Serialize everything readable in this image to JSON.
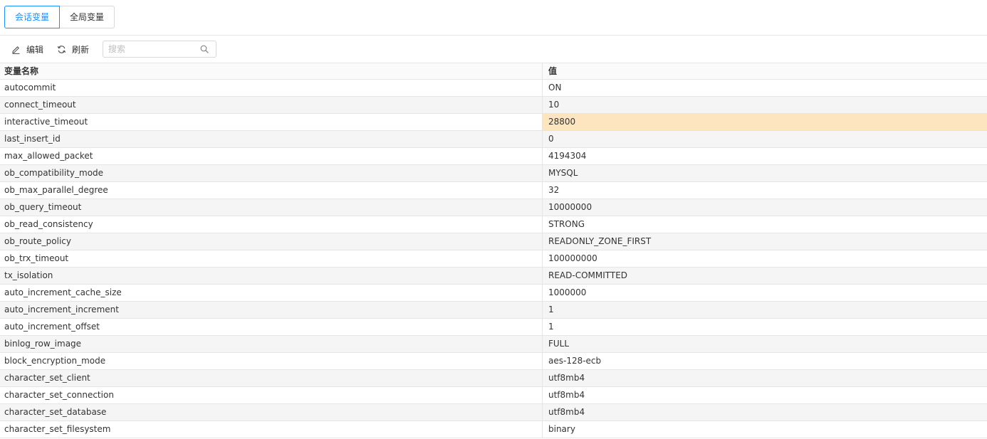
{
  "tabs": [
    {
      "label": "会话变量",
      "active": true
    },
    {
      "label": "全局变量",
      "active": false
    }
  ],
  "toolbar": {
    "edit_label": "编辑",
    "refresh_label": "刷新",
    "search_placeholder": "搜索",
    "search_value": ""
  },
  "icons": {
    "edit": "edit-icon",
    "refresh": "refresh-icon",
    "search": "search-icon"
  },
  "colors": {
    "accent": "#1890ff",
    "selected_cell": "#fde5bf",
    "stripe": "#f5f5f5"
  },
  "table": {
    "columns": [
      "变量名称",
      "值"
    ],
    "selected_row": 2,
    "rows": [
      {
        "name": "autocommit",
        "value": "ON"
      },
      {
        "name": "connect_timeout",
        "value": "10"
      },
      {
        "name": "interactive_timeout",
        "value": "28800"
      },
      {
        "name": "last_insert_id",
        "value": "0"
      },
      {
        "name": "max_allowed_packet",
        "value": "4194304"
      },
      {
        "name": "ob_compatibility_mode",
        "value": "MYSQL"
      },
      {
        "name": "ob_max_parallel_degree",
        "value": "32"
      },
      {
        "name": "ob_query_timeout",
        "value": "10000000"
      },
      {
        "name": "ob_read_consistency",
        "value": "STRONG"
      },
      {
        "name": "ob_route_policy",
        "value": "READONLY_ZONE_FIRST"
      },
      {
        "name": "ob_trx_timeout",
        "value": "100000000"
      },
      {
        "name": "tx_isolation",
        "value": "READ-COMMITTED"
      },
      {
        "name": "auto_increment_cache_size",
        "value": "1000000"
      },
      {
        "name": "auto_increment_increment",
        "value": "1"
      },
      {
        "name": "auto_increment_offset",
        "value": "1"
      },
      {
        "name": "binlog_row_image",
        "value": "FULL"
      },
      {
        "name": "block_encryption_mode",
        "value": "aes-128-ecb"
      },
      {
        "name": "character_set_client",
        "value": "utf8mb4"
      },
      {
        "name": "character_set_connection",
        "value": "utf8mb4"
      },
      {
        "name": "character_set_database",
        "value": "utf8mb4"
      },
      {
        "name": "character_set_filesystem",
        "value": "binary"
      }
    ]
  }
}
